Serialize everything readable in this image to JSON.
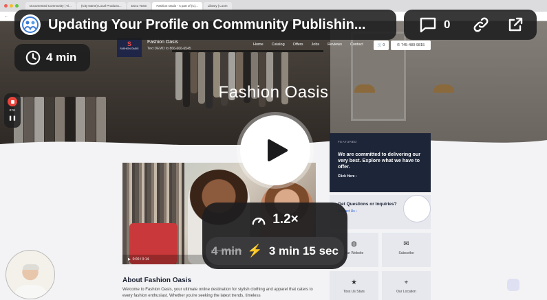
{
  "browser": {
    "tabs": [
      "Documented Community | Vi...",
      "(City Name) Local Products...",
      "Docu Team",
      "Fashion Oasis - A part of (C)...",
      "Library | Loom"
    ],
    "active_tab_index": 3
  },
  "site": {
    "logo_label": "FASHION OASIS",
    "brand_name": "Fashion Oasis",
    "brand_sub": "Text DEMO to 866-666-6545",
    "nav": [
      "Home",
      "Catalog",
      "Offers",
      "Jobs",
      "Reviews",
      "Contact"
    ],
    "cart_count": "0",
    "phone": "745-480-9815",
    "hero_title": "Fashion Oasis",
    "video_time": "0:00 / 0:14",
    "featured": {
      "label": "FEATURED",
      "text": "We are committed to delivering our very best. Explore what we have to offer.",
      "link": "Click Here"
    },
    "questions": {
      "title": "Get Questions or Inquiries?",
      "link": "Contact Us"
    },
    "tiles": [
      {
        "label": "Our Website",
        "icon": "globe-icon"
      },
      {
        "label": "Subscribe",
        "icon": "mail-icon"
      },
      {
        "label": "Toss Us Stars",
        "icon": "star-icon"
      },
      {
        "label": "Our Location",
        "icon": "map-icon"
      }
    ],
    "about_heading": "About Fashion Oasis",
    "about_text": "Welcome to Fashion Oasis, your ultimate online destination for stylish clothing and apparel that caters to every fashion enthusiast. Whether you're seeking the latest trends, timeless"
  },
  "loom": {
    "title": "Updating Your Profile on Community Publishin...",
    "duration": "4 min",
    "comments": "0",
    "recording_time": "0:01",
    "speed": "1.2×",
    "original_duration": "4 min",
    "sped_up_duration": "3 min 15 sec",
    "accent": "#e8453c",
    "bolt_color": "#f28a1e"
  }
}
